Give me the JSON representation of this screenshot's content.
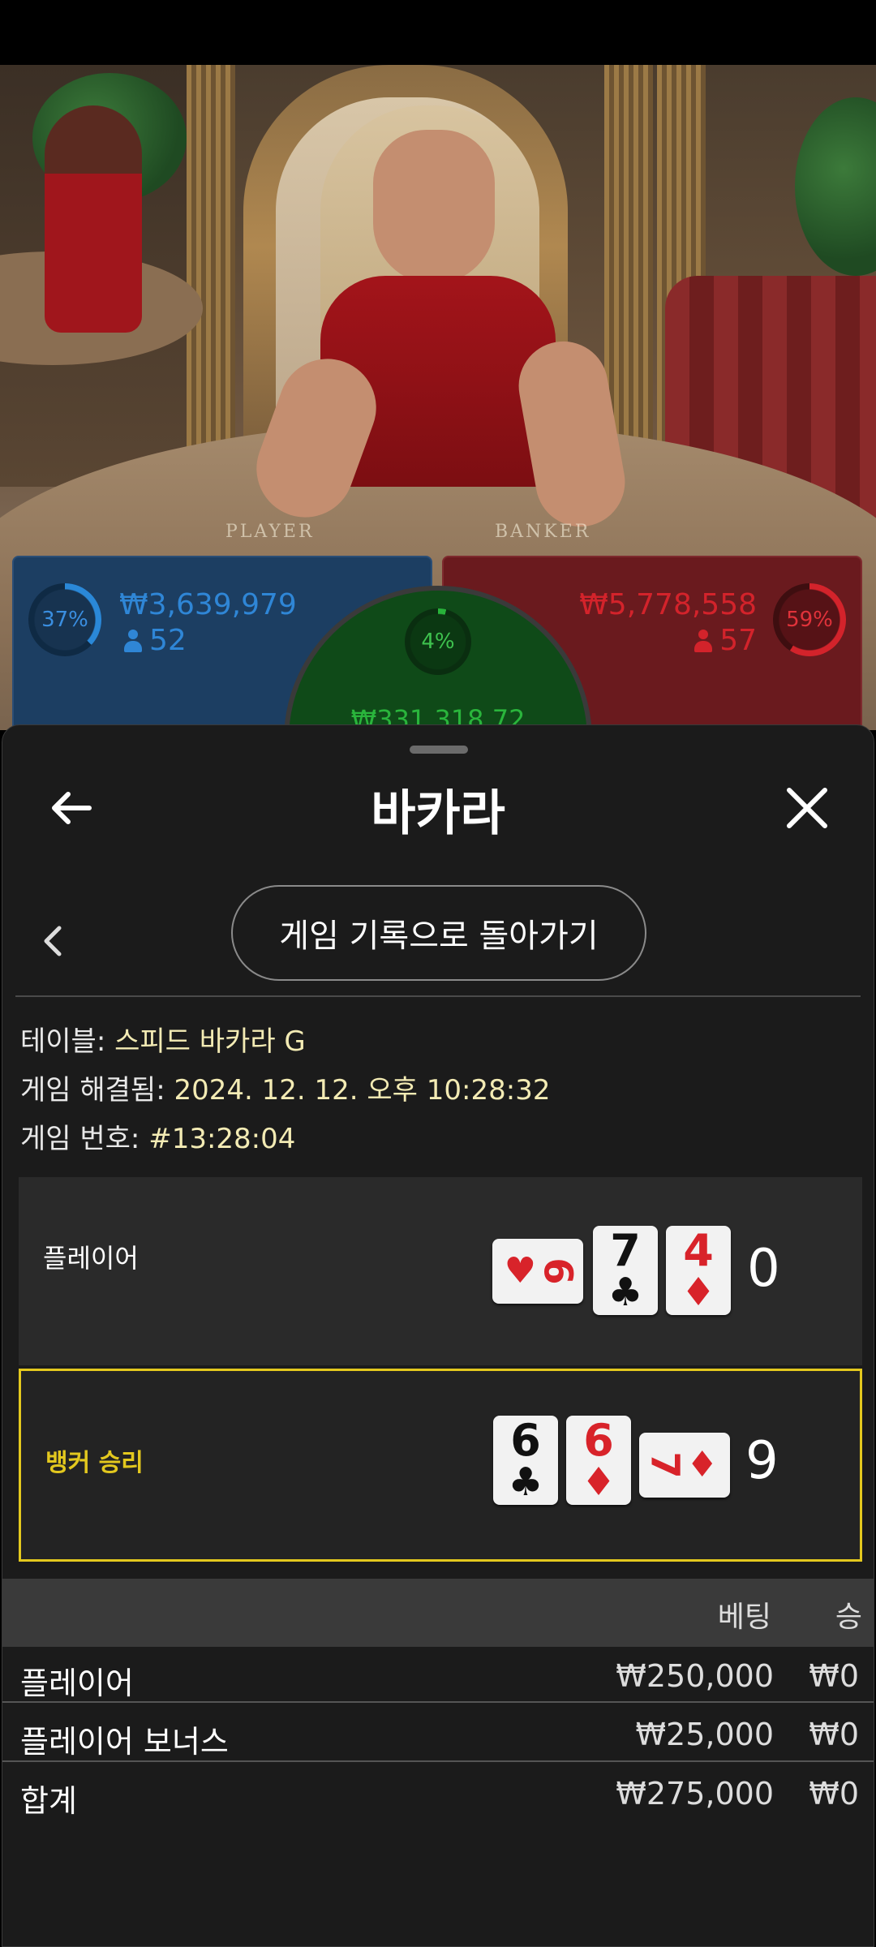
{
  "live_table": {
    "table_print_left": "PLAYER",
    "table_print_right": "BANKER",
    "player": {
      "percent": "37%",
      "amount": "₩3,639,979",
      "count": "52",
      "percent_value": 37
    },
    "banker": {
      "percent": "59%",
      "amount": "₩5,778,558",
      "count": "57",
      "percent_value": 59
    },
    "tie": {
      "percent": "4%",
      "amount": "₩331,318.72",
      "percent_value": 4
    },
    "colors": {
      "player": "#2a88d8",
      "banker": "#d3232b",
      "tie": "#28b33a"
    }
  },
  "sheet": {
    "title": "바카라",
    "back_icon": "arrow-left-icon",
    "close_icon": "close-icon",
    "history_button": "게임 기록으로 돌아가기",
    "info": {
      "table_label": "테이블:",
      "table_value": "스피드 바카라 G",
      "resolved_label": "게임 해결됨:",
      "resolved_value": "2024. 12. 12. 오후 10:28:32",
      "number_label": "게임 번호:",
      "number_value": "#13:28:04"
    },
    "hands": {
      "player": {
        "label": "플레이어",
        "score": "0",
        "cards": [
          {
            "rank": "6",
            "suit": "♥",
            "orientation": "horizontal"
          },
          {
            "rank": "7",
            "suit": "♣",
            "orientation": "vertical"
          },
          {
            "rank": "4",
            "suit": "♦",
            "orientation": "vertical"
          }
        ]
      },
      "banker": {
        "label": "뱅커 승리",
        "score": "9",
        "cards": [
          {
            "rank": "6",
            "suit": "♣",
            "orientation": "vertical"
          },
          {
            "rank": "6",
            "suit": "♦",
            "orientation": "vertical"
          },
          {
            "rank": "7",
            "suit": "♦",
            "orientation": "horizontal"
          }
        ],
        "highlight_color": "#e3c81e"
      }
    },
    "bets": {
      "col_bet": "베팅",
      "col_win": "승",
      "rows": [
        {
          "name": "플레이어",
          "bet": "₩250,000",
          "win": "₩0"
        },
        {
          "name": "플레이어 보너스",
          "bet": "₩25,000",
          "win": "₩0"
        }
      ],
      "total": {
        "name": "합계",
        "bet": "₩275,000",
        "win": "₩0"
      }
    }
  }
}
